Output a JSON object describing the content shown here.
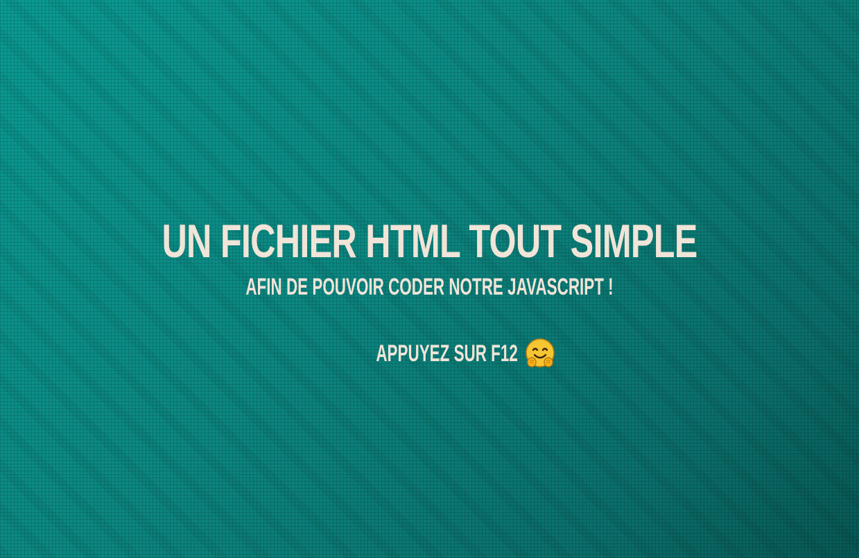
{
  "page": {
    "title": "UN FICHIER HTML TOUT SIMPLE",
    "subtitle": "AFIN DE POUVOIR CODER NOTRE JAVASCRIPT !",
    "hint": "APPUYEZ SUR F12",
    "hint_icon": "hugging-face-emoji-icon"
  },
  "colors": {
    "background": "#0d8a83",
    "text": "#f1e4d8",
    "emoji": "#f7c531"
  }
}
